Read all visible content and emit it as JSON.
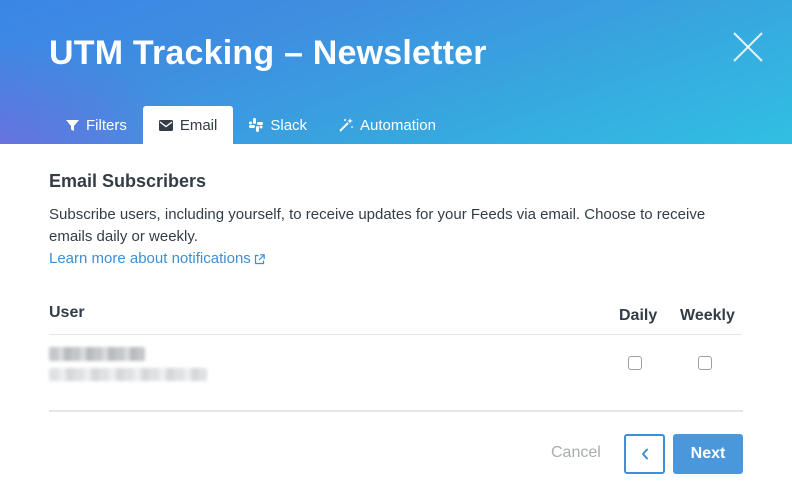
{
  "modal": {
    "title": "UTM Tracking – Newsletter",
    "close_icon": "close-icon"
  },
  "tabs": [
    {
      "label": "Filters",
      "icon": "filter-icon",
      "active": false
    },
    {
      "label": "Email",
      "icon": "envelope-icon",
      "active": true
    },
    {
      "label": "Slack",
      "icon": "slack-icon",
      "active": false
    },
    {
      "label": "Automation",
      "icon": "magic-wand-icon",
      "active": false
    }
  ],
  "email": {
    "section_title": "Email Subscribers",
    "description": "Subscribe users, including yourself, to receive updates for your Feeds via email. Choose to receive emails daily or weekly.",
    "learn_more": "Learn more about notifications"
  },
  "table": {
    "columns": {
      "user": "User",
      "daily": "Daily",
      "weekly": "Weekly"
    },
    "rows": [
      {
        "name": "[redacted]",
        "email": "[redacted]",
        "daily": false,
        "weekly": false
      }
    ]
  },
  "footer": {
    "cancel": "Cancel",
    "next": "Next"
  },
  "colors": {
    "accent": "#4b97dc",
    "link": "#3d8fd6",
    "header_gradient_start": "#925cde",
    "header_gradient_end": "#31bfe3"
  }
}
